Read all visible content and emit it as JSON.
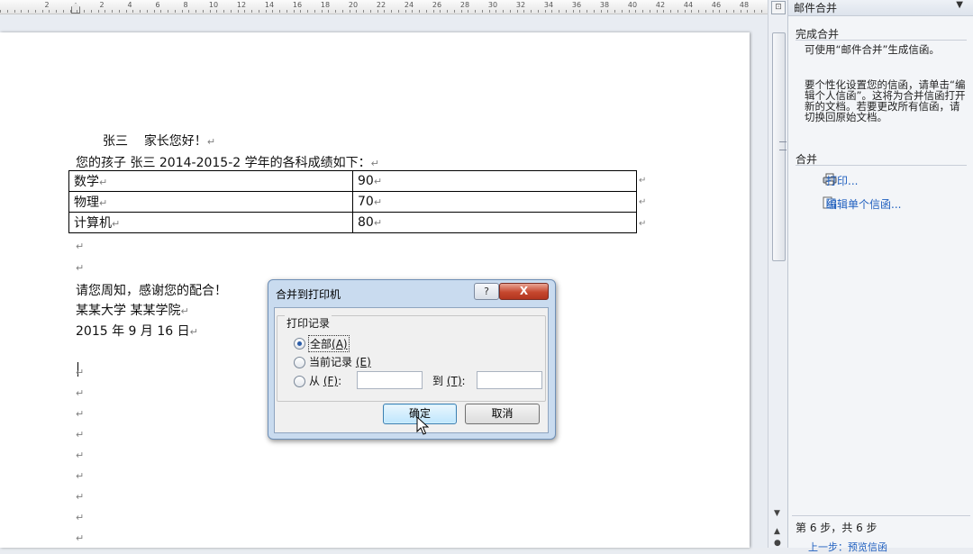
{
  "ruler": {
    "numbers": [
      "2",
      "2",
      "4",
      "6",
      "8",
      "10",
      "12",
      "14",
      "16",
      "18",
      "20",
      "22",
      "24",
      "26",
      "28",
      "30",
      "32",
      "34",
      "36",
      "38",
      "40",
      "42",
      "44",
      "46",
      "48"
    ]
  },
  "document": {
    "greeting_name": "张三",
    "greeting_text": "家长您好！",
    "intro": "您的孩子 张三 2014-2015-2 学年的各科成绩如下：",
    "table": [
      {
        "subject": "数学",
        "score": "90"
      },
      {
        "subject": "物理",
        "score": "70"
      },
      {
        "subject": "计算机",
        "score": "80"
      }
    ],
    "notice": "请您周知，感谢您的配合！",
    "signature": "某某大学 某某学院",
    "date": "2015 年 9 月 16 日",
    "para_mark": "↵"
  },
  "task_pane": {
    "title": "邮件合并",
    "section_done": "完成合并",
    "done_text_1": "可使用“邮件合并”生成信函。",
    "done_text_2": "要个性化设置您的信函，请单击“编辑个人信函”。这将为合并信函打开新的文档。若要更改所有信函，请切换回原始文档。",
    "section_merge": "合并",
    "link_print": "打印...",
    "link_edit": "编辑单个信函...",
    "step": "第 6 步，共 6 步",
    "prev_link": "上一步：预览信函"
  },
  "dialog": {
    "title": "合并到打印机",
    "help": "?",
    "close": "X",
    "group_label": "打印记录",
    "opt_all": "全部",
    "opt_all_key": "(A)",
    "opt_current": "当前记录",
    "opt_current_key": "(E)",
    "opt_from": "从",
    "opt_from_key": "(F)",
    "to_label": "到",
    "to_key": "(T)",
    "colon": ":",
    "ok": "确定",
    "cancel": "取消"
  }
}
